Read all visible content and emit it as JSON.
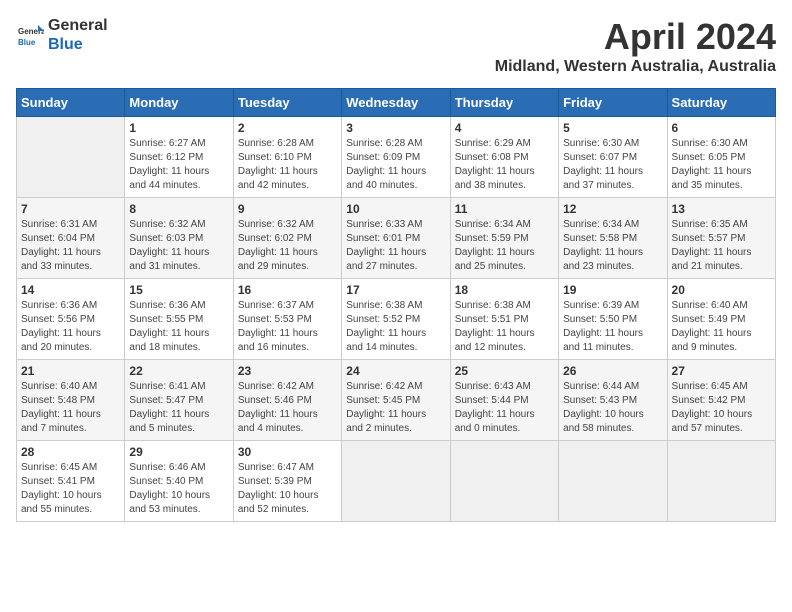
{
  "header": {
    "logo_line1": "General",
    "logo_line2": "Blue",
    "title": "April 2024",
    "subtitle": "Midland, Western Australia, Australia"
  },
  "weekdays": [
    "Sunday",
    "Monday",
    "Tuesday",
    "Wednesday",
    "Thursday",
    "Friday",
    "Saturday"
  ],
  "weeks": [
    [
      {
        "day": "",
        "content": ""
      },
      {
        "day": "1",
        "content": "Sunrise: 6:27 AM\nSunset: 6:12 PM\nDaylight: 11 hours\nand 44 minutes."
      },
      {
        "day": "2",
        "content": "Sunrise: 6:28 AM\nSunset: 6:10 PM\nDaylight: 11 hours\nand 42 minutes."
      },
      {
        "day": "3",
        "content": "Sunrise: 6:28 AM\nSunset: 6:09 PM\nDaylight: 11 hours\nand 40 minutes."
      },
      {
        "day": "4",
        "content": "Sunrise: 6:29 AM\nSunset: 6:08 PM\nDaylight: 11 hours\nand 38 minutes."
      },
      {
        "day": "5",
        "content": "Sunrise: 6:30 AM\nSunset: 6:07 PM\nDaylight: 11 hours\nand 37 minutes."
      },
      {
        "day": "6",
        "content": "Sunrise: 6:30 AM\nSunset: 6:05 PM\nDaylight: 11 hours\nand 35 minutes."
      }
    ],
    [
      {
        "day": "7",
        "content": "Sunrise: 6:31 AM\nSunset: 6:04 PM\nDaylight: 11 hours\nand 33 minutes."
      },
      {
        "day": "8",
        "content": "Sunrise: 6:32 AM\nSunset: 6:03 PM\nDaylight: 11 hours\nand 31 minutes."
      },
      {
        "day": "9",
        "content": "Sunrise: 6:32 AM\nSunset: 6:02 PM\nDaylight: 11 hours\nand 29 minutes."
      },
      {
        "day": "10",
        "content": "Sunrise: 6:33 AM\nSunset: 6:01 PM\nDaylight: 11 hours\nand 27 minutes."
      },
      {
        "day": "11",
        "content": "Sunrise: 6:34 AM\nSunset: 5:59 PM\nDaylight: 11 hours\nand 25 minutes."
      },
      {
        "day": "12",
        "content": "Sunrise: 6:34 AM\nSunset: 5:58 PM\nDaylight: 11 hours\nand 23 minutes."
      },
      {
        "day": "13",
        "content": "Sunrise: 6:35 AM\nSunset: 5:57 PM\nDaylight: 11 hours\nand 21 minutes."
      }
    ],
    [
      {
        "day": "14",
        "content": "Sunrise: 6:36 AM\nSunset: 5:56 PM\nDaylight: 11 hours\nand 20 minutes."
      },
      {
        "day": "15",
        "content": "Sunrise: 6:36 AM\nSunset: 5:55 PM\nDaylight: 11 hours\nand 18 minutes."
      },
      {
        "day": "16",
        "content": "Sunrise: 6:37 AM\nSunset: 5:53 PM\nDaylight: 11 hours\nand 16 minutes."
      },
      {
        "day": "17",
        "content": "Sunrise: 6:38 AM\nSunset: 5:52 PM\nDaylight: 11 hours\nand 14 minutes."
      },
      {
        "day": "18",
        "content": "Sunrise: 6:38 AM\nSunset: 5:51 PM\nDaylight: 11 hours\nand 12 minutes."
      },
      {
        "day": "19",
        "content": "Sunrise: 6:39 AM\nSunset: 5:50 PM\nDaylight: 11 hours\nand 11 minutes."
      },
      {
        "day": "20",
        "content": "Sunrise: 6:40 AM\nSunset: 5:49 PM\nDaylight: 11 hours\nand 9 minutes."
      }
    ],
    [
      {
        "day": "21",
        "content": "Sunrise: 6:40 AM\nSunset: 5:48 PM\nDaylight: 11 hours\nand 7 minutes."
      },
      {
        "day": "22",
        "content": "Sunrise: 6:41 AM\nSunset: 5:47 PM\nDaylight: 11 hours\nand 5 minutes."
      },
      {
        "day": "23",
        "content": "Sunrise: 6:42 AM\nSunset: 5:46 PM\nDaylight: 11 hours\nand 4 minutes."
      },
      {
        "day": "24",
        "content": "Sunrise: 6:42 AM\nSunset: 5:45 PM\nDaylight: 11 hours\nand 2 minutes."
      },
      {
        "day": "25",
        "content": "Sunrise: 6:43 AM\nSunset: 5:44 PM\nDaylight: 11 hours\nand 0 minutes."
      },
      {
        "day": "26",
        "content": "Sunrise: 6:44 AM\nSunset: 5:43 PM\nDaylight: 10 hours\nand 58 minutes."
      },
      {
        "day": "27",
        "content": "Sunrise: 6:45 AM\nSunset: 5:42 PM\nDaylight: 10 hours\nand 57 minutes."
      }
    ],
    [
      {
        "day": "28",
        "content": "Sunrise: 6:45 AM\nSunset: 5:41 PM\nDaylight: 10 hours\nand 55 minutes."
      },
      {
        "day": "29",
        "content": "Sunrise: 6:46 AM\nSunset: 5:40 PM\nDaylight: 10 hours\nand 53 minutes."
      },
      {
        "day": "30",
        "content": "Sunrise: 6:47 AM\nSunset: 5:39 PM\nDaylight: 10 hours\nand 52 minutes."
      },
      {
        "day": "",
        "content": ""
      },
      {
        "day": "",
        "content": ""
      },
      {
        "day": "",
        "content": ""
      },
      {
        "day": "",
        "content": ""
      }
    ]
  ]
}
